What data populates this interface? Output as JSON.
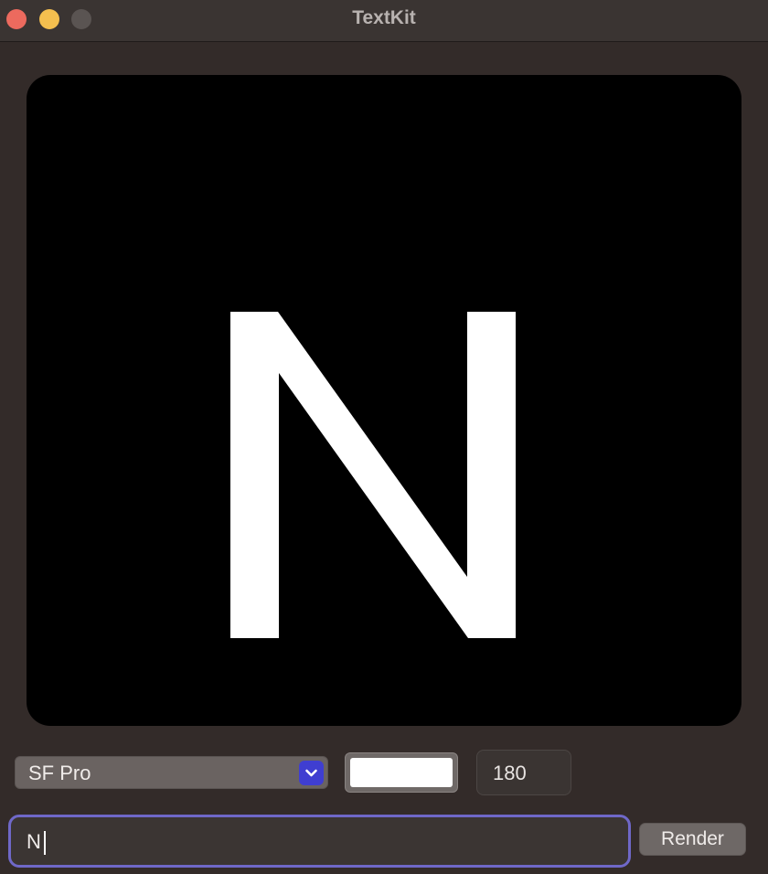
{
  "window": {
    "title": "TextKit"
  },
  "canvas": {
    "glyph_text": "N",
    "background_color": "#000000",
    "text_color": "#ffffff"
  },
  "controls": {
    "font_select": {
      "selected": "SF Pro",
      "icon": "chevron-down-icon"
    },
    "color_well": {
      "color": "#ffffff"
    },
    "size_field": {
      "value": "180"
    },
    "text_input": {
      "value": "N"
    },
    "render_button": {
      "label": "Render"
    }
  },
  "colors": {
    "accent": "#3f3ed1",
    "focus_ring": "#6f68c8",
    "close": "#ec6a5e",
    "minimize": "#f4bf4f"
  }
}
